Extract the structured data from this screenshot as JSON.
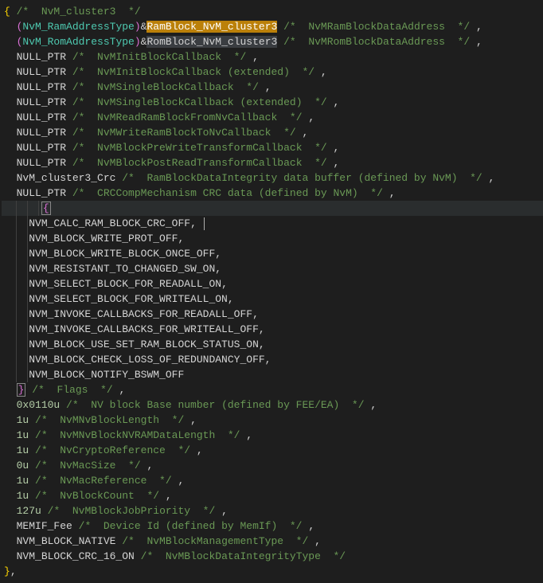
{
  "lines": [
    {
      "indent": 0,
      "tokens": [
        {
          "cls": "brace",
          "t": "{"
        },
        {
          "cls": "",
          "t": " "
        },
        {
          "cls": "comment",
          "t": "/*  NvM_cluster3  */"
        }
      ]
    },
    {
      "indent": 1,
      "tokens": [
        {
          "cls": "brace-pink",
          "t": "("
        },
        {
          "cls": "type",
          "t": "NvM_RamAddressType"
        },
        {
          "cls": "brace-pink",
          "t": ")"
        },
        {
          "cls": "operator",
          "t": "&"
        },
        {
          "cls": "highlight-sel",
          "t": "RamBlock_NvM_cluster3"
        },
        {
          "cls": "",
          "t": " "
        },
        {
          "cls": "comment",
          "t": "/*  NvMRamBlockDataAddress  */"
        },
        {
          "cls": "",
          "t": " "
        },
        {
          "cls": "punct",
          "t": ","
        }
      ]
    },
    {
      "indent": 1,
      "tokens": [
        {
          "cls": "brace-pink",
          "t": "("
        },
        {
          "cls": "type",
          "t": "NvM_RomAddressType"
        },
        {
          "cls": "brace-pink",
          "t": ")"
        },
        {
          "cls": "operator",
          "t": "&"
        },
        {
          "cls": "highlight-match",
          "t": "RomBlock_NvM_cluster3"
        },
        {
          "cls": "",
          "t": " "
        },
        {
          "cls": "comment",
          "t": "/*  NvMRomBlockDataAddress  */"
        },
        {
          "cls": "",
          "t": " "
        },
        {
          "cls": "punct",
          "t": ","
        }
      ]
    },
    {
      "indent": 1,
      "tokens": [
        {
          "cls": "constant",
          "t": "NULL_PTR"
        },
        {
          "cls": "",
          "t": " "
        },
        {
          "cls": "comment",
          "t": "/*  NvMInitBlockCallback  */"
        },
        {
          "cls": "",
          "t": " "
        },
        {
          "cls": "punct",
          "t": ","
        }
      ]
    },
    {
      "indent": 1,
      "tokens": [
        {
          "cls": "constant",
          "t": "NULL_PTR"
        },
        {
          "cls": "",
          "t": " "
        },
        {
          "cls": "comment",
          "t": "/*  NvMInitBlockCallback (extended)  */"
        },
        {
          "cls": "",
          "t": " "
        },
        {
          "cls": "punct",
          "t": ","
        }
      ]
    },
    {
      "indent": 1,
      "tokens": [
        {
          "cls": "constant",
          "t": "NULL_PTR"
        },
        {
          "cls": "",
          "t": " "
        },
        {
          "cls": "comment",
          "t": "/*  NvMSingleBlockCallback  */"
        },
        {
          "cls": "",
          "t": " "
        },
        {
          "cls": "punct",
          "t": ","
        }
      ]
    },
    {
      "indent": 1,
      "tokens": [
        {
          "cls": "constant",
          "t": "NULL_PTR"
        },
        {
          "cls": "",
          "t": " "
        },
        {
          "cls": "comment",
          "t": "/*  NvMSingleBlockCallback (extended)  */"
        },
        {
          "cls": "",
          "t": " "
        },
        {
          "cls": "punct",
          "t": ","
        }
      ]
    },
    {
      "indent": 1,
      "tokens": [
        {
          "cls": "constant",
          "t": "NULL_PTR"
        },
        {
          "cls": "",
          "t": " "
        },
        {
          "cls": "comment",
          "t": "/*  NvMReadRamBlockFromNvCallback  */"
        },
        {
          "cls": "",
          "t": " "
        },
        {
          "cls": "punct",
          "t": ","
        }
      ]
    },
    {
      "indent": 1,
      "tokens": [
        {
          "cls": "constant",
          "t": "NULL_PTR"
        },
        {
          "cls": "",
          "t": " "
        },
        {
          "cls": "comment",
          "t": "/*  NvMWriteRamBlockToNvCallback  */"
        },
        {
          "cls": "",
          "t": " "
        },
        {
          "cls": "punct",
          "t": ","
        }
      ]
    },
    {
      "indent": 1,
      "tokens": [
        {
          "cls": "constant",
          "t": "NULL_PTR"
        },
        {
          "cls": "",
          "t": " "
        },
        {
          "cls": "comment",
          "t": "/*  NvMBlockPreWriteTransformCallback  */"
        },
        {
          "cls": "",
          "t": " "
        },
        {
          "cls": "punct",
          "t": ","
        }
      ]
    },
    {
      "indent": 1,
      "tokens": [
        {
          "cls": "constant",
          "t": "NULL_PTR"
        },
        {
          "cls": "",
          "t": " "
        },
        {
          "cls": "comment",
          "t": "/*  NvMBlockPostReadTransformCallback  */"
        },
        {
          "cls": "",
          "t": " "
        },
        {
          "cls": "punct",
          "t": ","
        }
      ]
    },
    {
      "indent": 1,
      "tokens": [
        {
          "cls": "constant",
          "t": "NvM_cluster3_Crc"
        },
        {
          "cls": "",
          "t": " "
        },
        {
          "cls": "comment",
          "t": "/*  RamBlockDataIntegrity data buffer (defined by NvM)  */"
        },
        {
          "cls": "",
          "t": " "
        },
        {
          "cls": "punct",
          "t": ","
        }
      ]
    },
    {
      "indent": 1,
      "tokens": [
        {
          "cls": "constant",
          "t": "NULL_PTR"
        },
        {
          "cls": "",
          "t": " "
        },
        {
          "cls": "comment",
          "t": "/*  CRCCompMechanism CRC data (defined by NvM)  */"
        },
        {
          "cls": "",
          "t": " "
        },
        {
          "cls": "punct",
          "t": ","
        }
      ]
    },
    {
      "indent": 3,
      "guides": [
        1,
        2,
        3
      ],
      "current": true,
      "tokens": [
        {
          "cls": "brace-pink bracket-highlight",
          "t": "{"
        }
      ]
    },
    {
      "indent": 2,
      "guides": [
        1,
        2
      ],
      "tokens": [
        {
          "cls": "constant",
          "t": "NVM_CALC_RAM_BLOCK_CRC_OFF"
        },
        {
          "cls": "punct",
          "t": ","
        },
        {
          "cls": "",
          "t": " "
        },
        {
          "cls": "cursor",
          "t": ""
        }
      ]
    },
    {
      "indent": 2,
      "guides": [
        1,
        2
      ],
      "tokens": [
        {
          "cls": "constant",
          "t": "NVM_BLOCK_WRITE_PROT_OFF"
        },
        {
          "cls": "punct",
          "t": ","
        }
      ]
    },
    {
      "indent": 2,
      "guides": [
        1,
        2
      ],
      "tokens": [
        {
          "cls": "constant",
          "t": "NVM_BLOCK_WRITE_BLOCK_ONCE_OFF"
        },
        {
          "cls": "punct",
          "t": ","
        }
      ]
    },
    {
      "indent": 2,
      "guides": [
        1,
        2
      ],
      "tokens": [
        {
          "cls": "constant",
          "t": "NVM_RESISTANT_TO_CHANGED_SW_ON"
        },
        {
          "cls": "punct",
          "t": ","
        }
      ]
    },
    {
      "indent": 2,
      "guides": [
        1,
        2
      ],
      "tokens": [
        {
          "cls": "constant",
          "t": "NVM_SELECT_BLOCK_FOR_READALL_ON"
        },
        {
          "cls": "punct",
          "t": ","
        }
      ]
    },
    {
      "indent": 2,
      "guides": [
        1,
        2
      ],
      "tokens": [
        {
          "cls": "constant",
          "t": "NVM_SELECT_BLOCK_FOR_WRITEALL_ON"
        },
        {
          "cls": "punct",
          "t": ","
        }
      ]
    },
    {
      "indent": 2,
      "guides": [
        1,
        2
      ],
      "tokens": [
        {
          "cls": "constant",
          "t": "NVM_INVOKE_CALLBACKS_FOR_READALL_OFF"
        },
        {
          "cls": "punct",
          "t": ","
        }
      ]
    },
    {
      "indent": 2,
      "guides": [
        1,
        2
      ],
      "tokens": [
        {
          "cls": "constant",
          "t": "NVM_INVOKE_CALLBACKS_FOR_WRITEALL_OFF"
        },
        {
          "cls": "punct",
          "t": ","
        }
      ]
    },
    {
      "indent": 2,
      "guides": [
        1,
        2
      ],
      "tokens": [
        {
          "cls": "constant",
          "t": "NVM_BLOCK_USE_SET_RAM_BLOCK_STATUS_ON"
        },
        {
          "cls": "punct",
          "t": ","
        }
      ]
    },
    {
      "indent": 2,
      "guides": [
        1,
        2
      ],
      "tokens": [
        {
          "cls": "constant",
          "t": "NVM_BLOCK_CHECK_LOSS_OF_REDUNDANCY_OFF"
        },
        {
          "cls": "punct",
          "t": ","
        }
      ]
    },
    {
      "indent": 2,
      "guides": [
        1,
        2
      ],
      "tokens": [
        {
          "cls": "constant",
          "t": "NVM_BLOCK_NOTIFY_BSWM_OFF"
        }
      ]
    },
    {
      "indent": 1,
      "tokens": [
        {
          "cls": "brace-pink bracket-highlight",
          "t": "}"
        },
        {
          "cls": "",
          "t": " "
        },
        {
          "cls": "comment",
          "t": "/*  Flags  */"
        },
        {
          "cls": "",
          "t": " "
        },
        {
          "cls": "punct",
          "t": ","
        }
      ]
    },
    {
      "indent": 1,
      "tokens": [
        {
          "cls": "number",
          "t": "0x0110u"
        },
        {
          "cls": "",
          "t": " "
        },
        {
          "cls": "comment",
          "t": "/*  NV block Base number (defined by FEE/EA)  */"
        },
        {
          "cls": "",
          "t": " "
        },
        {
          "cls": "punct",
          "t": ","
        }
      ]
    },
    {
      "indent": 1,
      "tokens": [
        {
          "cls": "number",
          "t": "1u"
        },
        {
          "cls": "",
          "t": " "
        },
        {
          "cls": "comment",
          "t": "/*  NvMNvBlockLength  */"
        },
        {
          "cls": "",
          "t": " "
        },
        {
          "cls": "punct",
          "t": ","
        }
      ]
    },
    {
      "indent": 1,
      "tokens": [
        {
          "cls": "number",
          "t": "1u"
        },
        {
          "cls": "",
          "t": " "
        },
        {
          "cls": "comment",
          "t": "/*  NvMNvBlockNVRAMDataLength  */"
        },
        {
          "cls": "",
          "t": " "
        },
        {
          "cls": "punct",
          "t": ","
        }
      ]
    },
    {
      "indent": 1,
      "tokens": [
        {
          "cls": "number",
          "t": "1u"
        },
        {
          "cls": "",
          "t": " "
        },
        {
          "cls": "comment",
          "t": "/*  NvCryptoReference  */"
        },
        {
          "cls": "",
          "t": " "
        },
        {
          "cls": "punct",
          "t": ","
        }
      ]
    },
    {
      "indent": 1,
      "tokens": [
        {
          "cls": "number",
          "t": "0u"
        },
        {
          "cls": "",
          "t": " "
        },
        {
          "cls": "comment",
          "t": "/*  NvMacSize  */"
        },
        {
          "cls": "",
          "t": " "
        },
        {
          "cls": "punct",
          "t": ","
        }
      ]
    },
    {
      "indent": 1,
      "tokens": [
        {
          "cls": "number",
          "t": "1u"
        },
        {
          "cls": "",
          "t": " "
        },
        {
          "cls": "comment",
          "t": "/*  NvMacReference  */"
        },
        {
          "cls": "",
          "t": " "
        },
        {
          "cls": "punct",
          "t": ","
        }
      ]
    },
    {
      "indent": 1,
      "tokens": [
        {
          "cls": "number",
          "t": "1u"
        },
        {
          "cls": "",
          "t": " "
        },
        {
          "cls": "comment",
          "t": "/*  NvBlockCount  */"
        },
        {
          "cls": "",
          "t": " "
        },
        {
          "cls": "punct",
          "t": ","
        }
      ]
    },
    {
      "indent": 1,
      "tokens": [
        {
          "cls": "number",
          "t": "127u"
        },
        {
          "cls": "",
          "t": " "
        },
        {
          "cls": "comment",
          "t": "/*  NvMBlockJobPriority  */"
        },
        {
          "cls": "",
          "t": " "
        },
        {
          "cls": "punct",
          "t": ","
        }
      ]
    },
    {
      "indent": 1,
      "tokens": [
        {
          "cls": "constant",
          "t": "MEMIF_Fee"
        },
        {
          "cls": "",
          "t": " "
        },
        {
          "cls": "comment",
          "t": "/*  Device Id (defined by MemIf)  */"
        },
        {
          "cls": "",
          "t": " "
        },
        {
          "cls": "punct",
          "t": ","
        }
      ]
    },
    {
      "indent": 1,
      "tokens": [
        {
          "cls": "constant",
          "t": "NVM_BLOCK_NATIVE"
        },
        {
          "cls": "",
          "t": " "
        },
        {
          "cls": "comment",
          "t": "/*  NvMBlockManagementType  */"
        },
        {
          "cls": "",
          "t": " "
        },
        {
          "cls": "punct",
          "t": ","
        }
      ]
    },
    {
      "indent": 1,
      "tokens": [
        {
          "cls": "constant",
          "t": "NVM_BLOCK_CRC_16_ON"
        },
        {
          "cls": "",
          "t": " "
        },
        {
          "cls": "comment",
          "t": "/*  NvMBlockDataIntegrityType  */"
        }
      ]
    },
    {
      "indent": 0,
      "tokens": [
        {
          "cls": "brace",
          "t": "}"
        },
        {
          "cls": "punct",
          "t": ","
        }
      ]
    }
  ],
  "indentUnit": "  "
}
